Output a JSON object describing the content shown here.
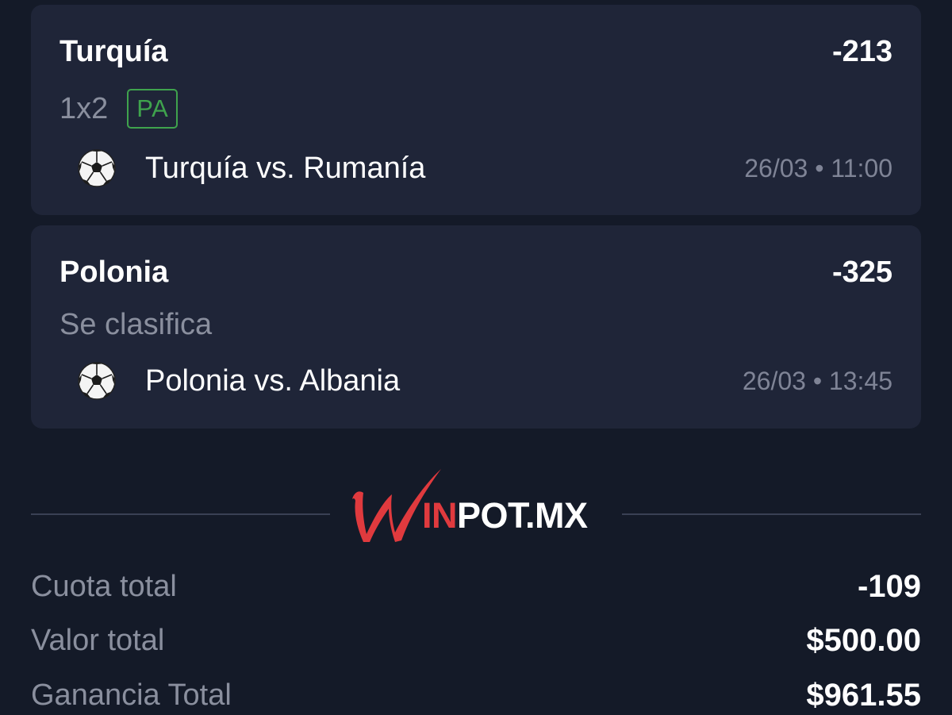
{
  "bets": [
    {
      "selection": "Turquía",
      "odds": "-213",
      "market": "1x2",
      "badge": "PA",
      "event": "Turquía vs. Rumanía",
      "datetime": "26/03 • 11:00",
      "sport_icon": "soccer-ball-icon"
    },
    {
      "selection": "Polonia",
      "odds": "-325",
      "market": "Se clasifica",
      "event": "Polonia vs. Albania",
      "datetime": "26/03 • 13:45",
      "sport_icon": "soccer-ball-icon"
    }
  ],
  "logo": {
    "text_red": "IN",
    "text_white": "POT.MX",
    "color_red": "#e03a3e"
  },
  "summary": {
    "odds_label": "Cuota total",
    "odds_value": "-109",
    "stake_label": "Valor total",
    "stake_value": "$500.00",
    "payout_label": "Ganancia Total",
    "payout_value": "$961.55"
  },
  "colors": {
    "background": "#141a28",
    "card": "#1f2538",
    "muted_text": "#8a8f9e",
    "badge_green": "#3fa34d"
  }
}
